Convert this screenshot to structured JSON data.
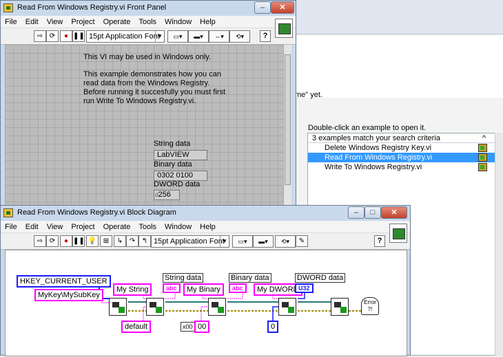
{
  "example_finder": {
    "partial_text": "me\" yet.",
    "instruction": "Double-click an example to open it.",
    "list_header": "3 examples match your search criteria",
    "items": [
      {
        "label": "Delete Windows Registry Key.vi",
        "selected": false
      },
      {
        "label": "Read From Windows Registry.vi",
        "selected": true
      },
      {
        "label": "Write To Windows Registry.vi",
        "selected": false
      }
    ]
  },
  "front_panel": {
    "title": "Read From Windows Registry.vi Front Panel",
    "menu": [
      "File",
      "Edit",
      "View",
      "Project",
      "Operate",
      "Tools",
      "Window",
      "Help"
    ],
    "font_select": "15pt Application Font",
    "note_line1": "This VI may be used in Windows only.",
    "note_para": "This example demonstrates how you can read data from the Windows Registry. Before running it succesfully you must first run Write To Windows Registry.vi.",
    "string_label": "String data",
    "string_value": "LabVIEW",
    "binary_label": "Binary data",
    "binary_value": "0302 0100",
    "dword_label": "DWORD data",
    "dword_value": "256",
    "dword_radix": "d"
  },
  "block_diagram": {
    "title": "Read From Windows Registry.vi Block Diagram",
    "menu": [
      "File",
      "Edit",
      "View",
      "Project",
      "Operate",
      "Tools",
      "Window",
      "Help"
    ],
    "font_select": "15pt Application Font",
    "hkey": "HKEY_CURRENT_USER",
    "key_path": "MyKey\\MySubKey",
    "my_string": "My String",
    "my_binary": "My Binary",
    "my_dword": "My DWORD",
    "string_data_label": "String data",
    "binary_data_label": "Binary data",
    "dword_data_label": "DWORD data",
    "abc_term": "abc",
    "u32_term": "U32",
    "default_const": "default",
    "binary_default_prefix": "x00",
    "binary_default": "00",
    "dword_default": "0",
    "error_label": "Error ?!"
  },
  "colors": {
    "string_wire": "#ff00ff",
    "int_wire": "#1a1aff",
    "error_wire": "#a08c00",
    "selection": "#3399ff"
  }
}
